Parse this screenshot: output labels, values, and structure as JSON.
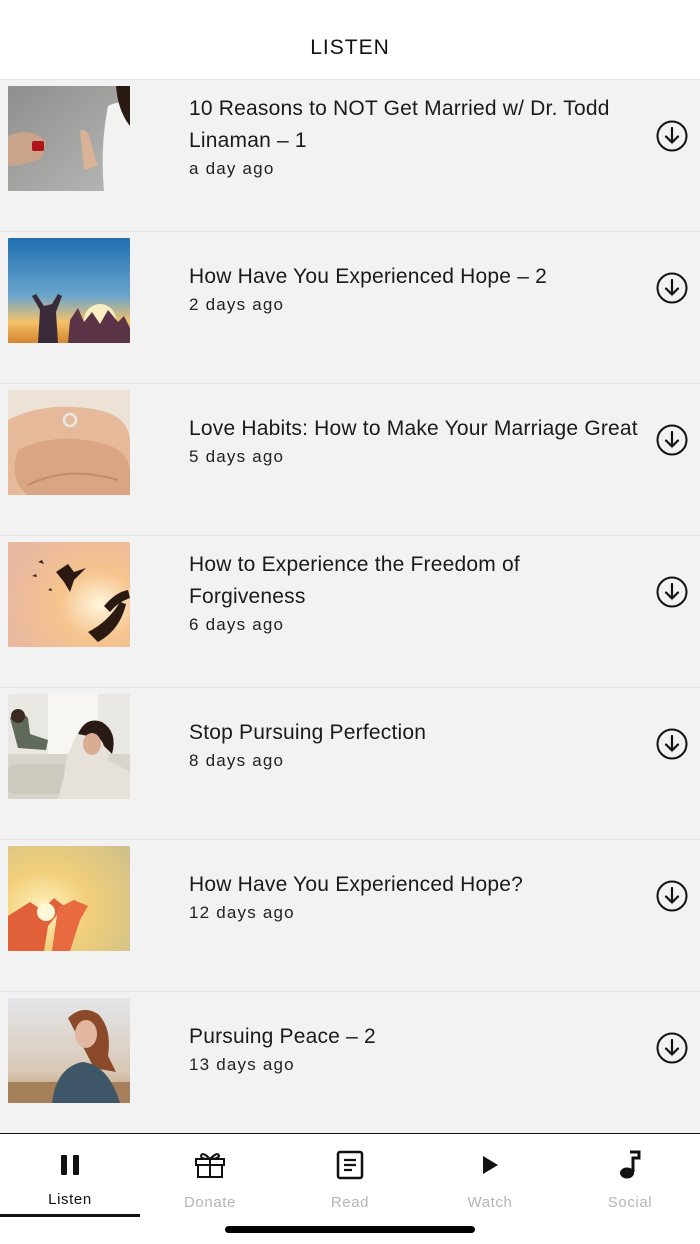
{
  "header": {
    "title": "LISTEN"
  },
  "episodes": [
    {
      "title": "10 Reasons to NOT Get Married w/ Dr. Todd Linaman – 1",
      "date": "a day ago"
    },
    {
      "title": "How Have You Experienced Hope – 2",
      "date": "2 days ago"
    },
    {
      "title": "Love Habits: How to Make Your Marriage Great",
      "date": "5 days ago"
    },
    {
      "title": "How to Experience the Freedom of Forgiveness",
      "date": "6 days ago"
    },
    {
      "title": "Stop Pursuing Perfection",
      "date": "8 days ago"
    },
    {
      "title": "How Have You Experienced Hope?",
      "date": "12 days ago"
    },
    {
      "title": "Pursuing Peace – 2",
      "date": "13 days ago"
    }
  ],
  "tabs": [
    {
      "label": "Listen",
      "icon": "pause-icon",
      "active": true
    },
    {
      "label": "Donate",
      "icon": "gift-icon",
      "active": false
    },
    {
      "label": "Read",
      "icon": "document-icon",
      "active": false
    },
    {
      "label": "Watch",
      "icon": "play-icon",
      "active": false
    },
    {
      "label": "Social",
      "icon": "music-note-icon",
      "active": false
    }
  ],
  "colors": {
    "accent": "#111111",
    "inactive_tab": "#b5b5b5",
    "list_bg": "#f2f2f2"
  }
}
